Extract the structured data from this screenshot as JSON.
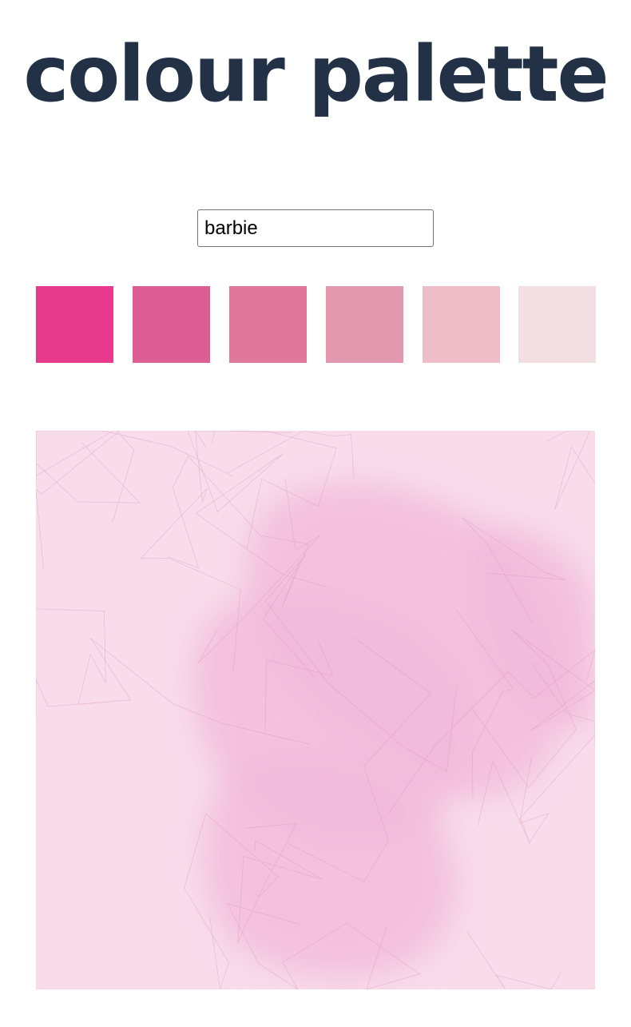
{
  "page": {
    "title": "colour palette",
    "title_color": "#223146"
  },
  "search": {
    "value": "barbie"
  },
  "palette": {
    "swatches": [
      {
        "color": "#e83a8c"
      },
      {
        "color": "#dd5e93"
      },
      {
        "color": "#e2779c"
      },
      {
        "color": "#e498ad"
      },
      {
        "color": "#eebec8"
      },
      {
        "color": "#f3dfe1"
      }
    ]
  },
  "artwork": {
    "background_color": "#f8dcea",
    "blob_color": "#f2b8d9",
    "line_color": "#d98fb9"
  }
}
